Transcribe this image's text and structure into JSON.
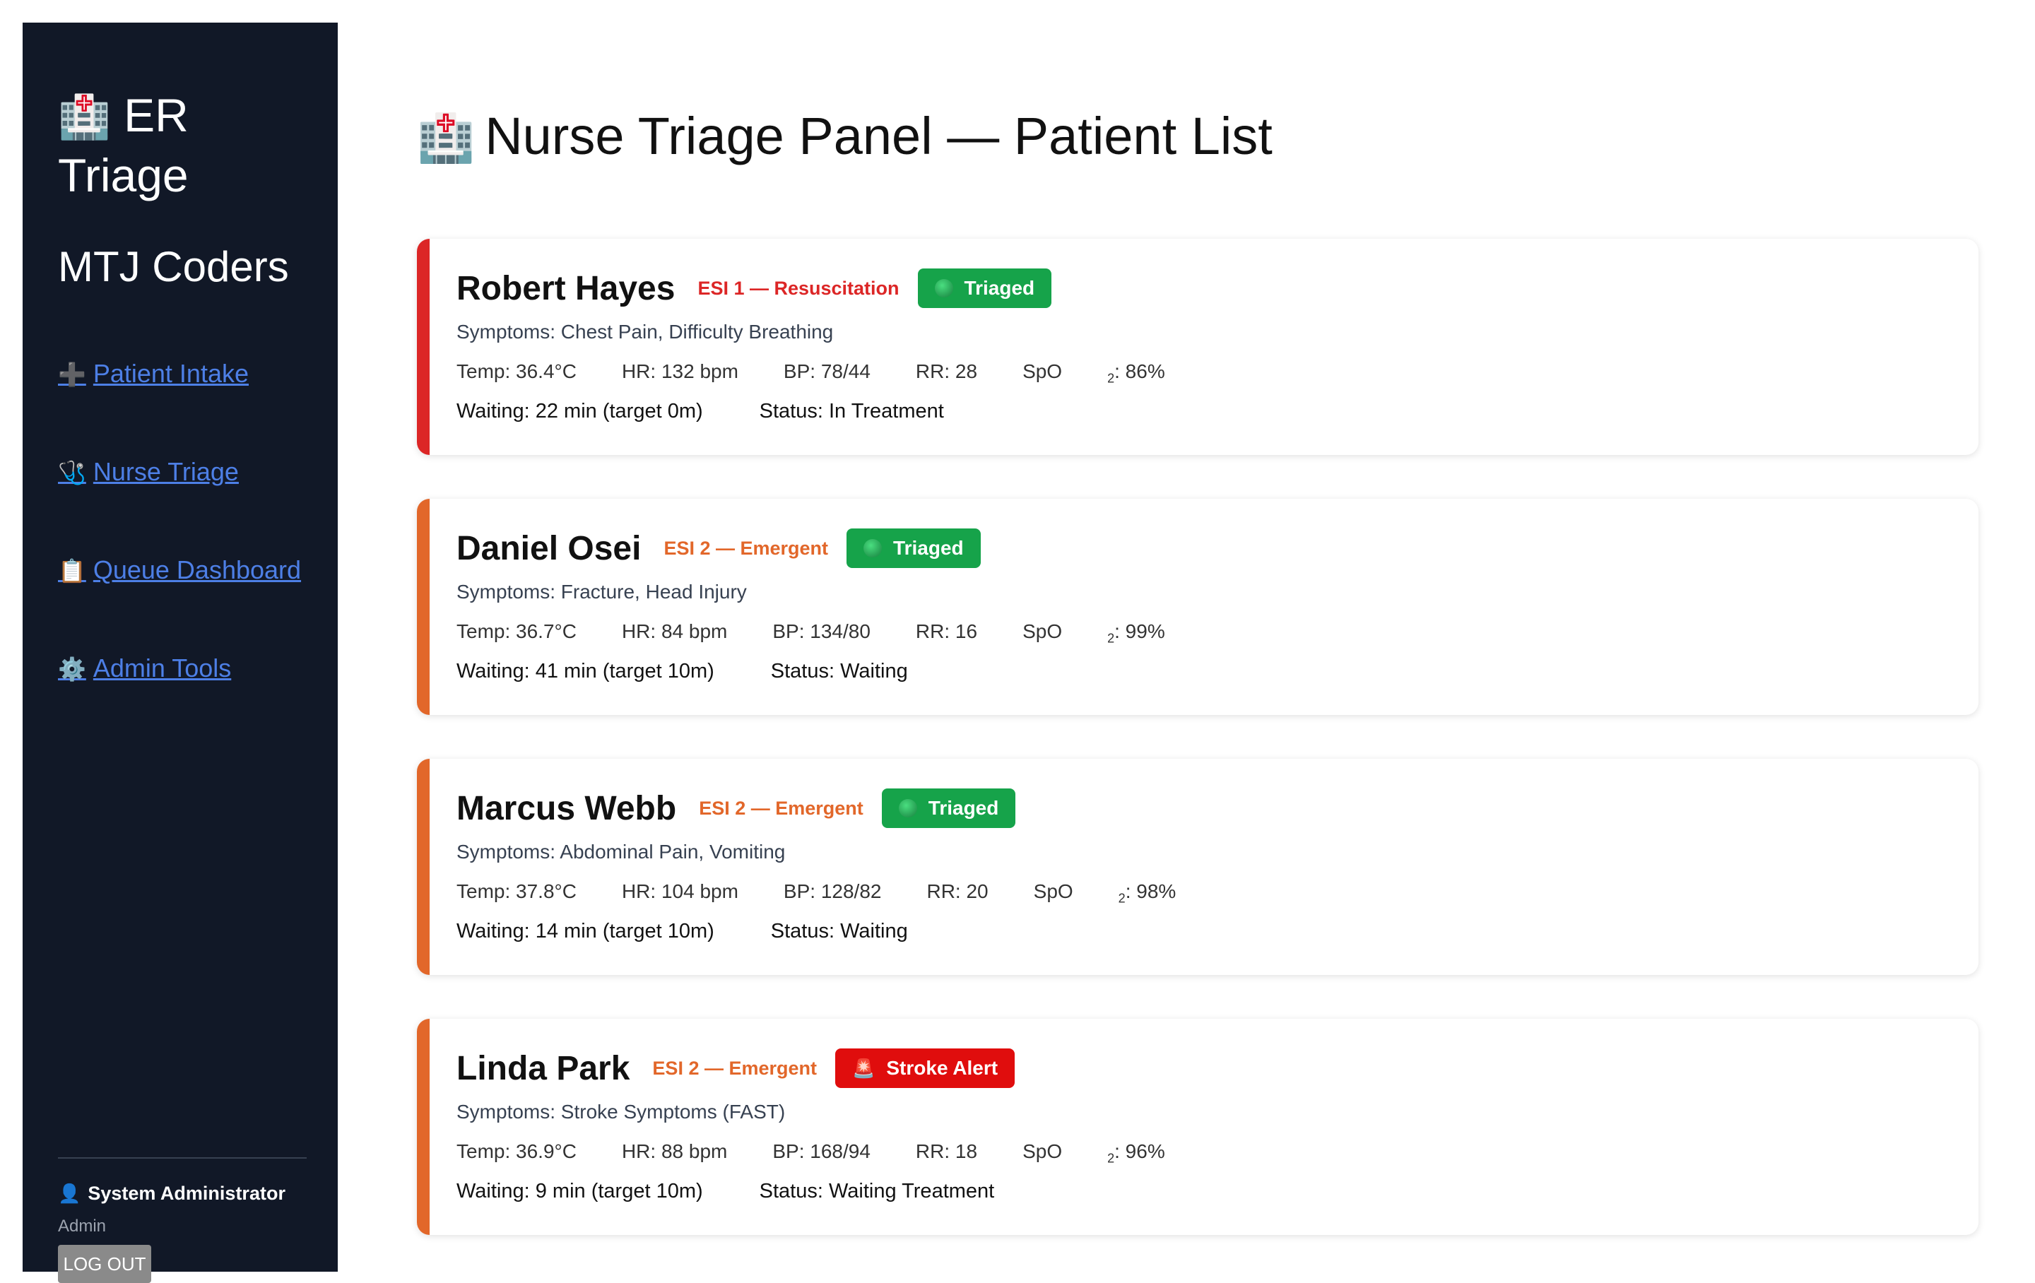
{
  "sidebar": {
    "brand_icon": "🏥",
    "brand_text": "ER Triage",
    "team": "MTJ Coders",
    "nav": [
      {
        "icon": "➕",
        "label": "Patient Intake"
      },
      {
        "icon": "🩺",
        "label": "Nurse Triage"
      },
      {
        "icon": "📋",
        "label": "Queue Dashboard"
      },
      {
        "icon": "⚙️",
        "label": "Admin Tools"
      }
    ],
    "user_icon": "👤",
    "user_name": "System Administrator",
    "user_role": "Admin",
    "logout_label": "LOG OUT"
  },
  "main": {
    "title_icon": "🏥",
    "title": "Nurse Triage Panel — Patient List"
  },
  "patients": [
    {
      "name": "Robert Hayes",
      "esi": "ESI 1 — Resuscitation",
      "badge": "Triaged",
      "symptoms": "Symptoms: Chest Pain, Difficulty Breathing",
      "temp": "Temp: 36.4°C",
      "hr": "HR: 132 bpm",
      "bp": "BP: 78/44",
      "rr": "RR: 28",
      "spo2_prefix": "SpO",
      "spo2_sub": "2",
      "spo2_value": ": 86%",
      "waiting": "Waiting: 22 min (target 0m)",
      "status": "Status: In Treatment"
    },
    {
      "name": "Daniel Osei",
      "esi": "ESI 2 — Emergent",
      "badge": "Triaged",
      "symptoms": "Symptoms: Fracture, Head Injury",
      "temp": "Temp: 36.7°C",
      "hr": "HR: 84 bpm",
      "bp": "BP: 134/80",
      "rr": "RR: 16",
      "spo2_prefix": "SpO",
      "spo2_sub": "2",
      "spo2_value": ": 99%",
      "waiting": "Waiting: 41 min (target 10m)",
      "status": "Status: Waiting"
    },
    {
      "name": "Marcus Webb",
      "esi": "ESI 2 — Emergent",
      "badge": "Triaged",
      "symptoms": "Symptoms: Abdominal Pain, Vomiting",
      "temp": "Temp: 37.8°C",
      "hr": "HR: 104 bpm",
      "bp": "BP: 128/82",
      "rr": "RR: 20",
      "spo2_prefix": "SpO",
      "spo2_sub": "2",
      "spo2_value": ": 98%",
      "waiting": "Waiting: 14 min (target 10m)",
      "status": "Status: Waiting"
    },
    {
      "name": "Linda Park",
      "esi": "ESI 2 — Emergent",
      "badge": "Stroke Alert",
      "badge_icon": "🚨",
      "symptoms": "Symptoms: Stroke Symptoms (FAST)",
      "temp": "Temp: 36.9°C",
      "hr": "HR: 88 bpm",
      "bp": "BP: 168/94",
      "rr": "RR: 18",
      "spo2_prefix": "SpO",
      "spo2_sub": "2",
      "spo2_value": ": 96%",
      "waiting": "Waiting: 9 min (target 10m)",
      "status": "Status: Waiting Treatment"
    }
  ],
  "colors": {
    "sidebar_bg": "#111827",
    "esi1": "#dc2626",
    "esi2": "#e2672a",
    "triaged": "#16a34a",
    "alert": "#e00d0d",
    "link": "#4d7fe6"
  }
}
